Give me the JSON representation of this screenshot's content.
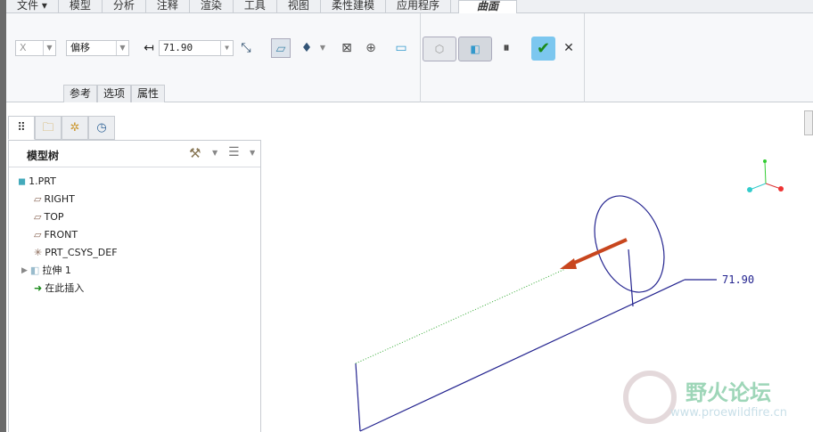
{
  "menu_tabs": [
    {
      "label": "文件 ▾"
    },
    {
      "label": "模型"
    },
    {
      "label": "分析"
    },
    {
      "label": "注释"
    },
    {
      "label": "渲染"
    },
    {
      "label": "工具"
    },
    {
      "label": "视图"
    },
    {
      "label": "柔性建模"
    },
    {
      "label": "应用程序"
    },
    {
      "label": "曲面"
    }
  ],
  "ribbon": {
    "axis_select": "X",
    "type_select": "偏移",
    "distance_value": "71.90",
    "subtabs": [
      "参考",
      "选项",
      "属性"
    ]
  },
  "model_tree": {
    "title": "模型树",
    "items": [
      {
        "label": "1.PRT"
      },
      {
        "label": "RIGHT"
      },
      {
        "label": "TOP"
      },
      {
        "label": "FRONT"
      },
      {
        "label": "PRT_CSYS_DEF"
      },
      {
        "label": "拉伸 1"
      },
      {
        "label": "在此插入"
      }
    ]
  },
  "viewport": {
    "dimension_label": "71.90",
    "watermark_title": "野火论坛",
    "watermark_url": "www.proewildfire.cn"
  }
}
